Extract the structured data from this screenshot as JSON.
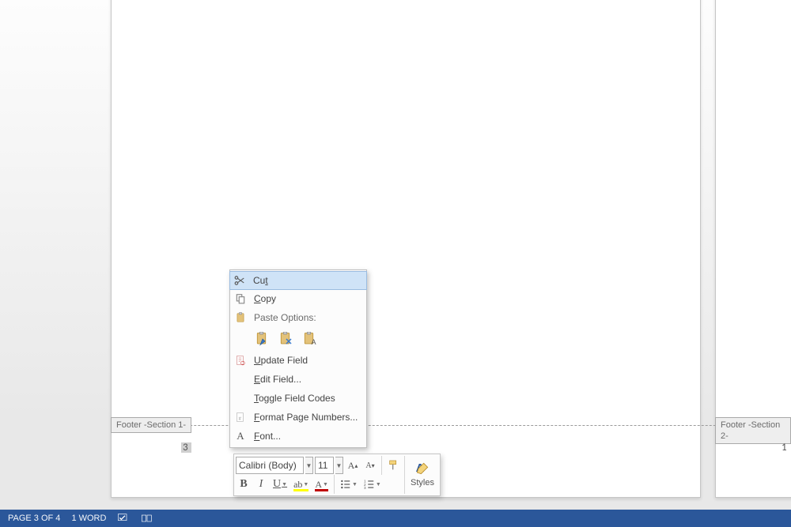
{
  "footer_tabs": {
    "left": "Footer -Section 1-",
    "right": "Footer -Section 2-"
  },
  "page_numbers": {
    "left": "3",
    "right": "1"
  },
  "context_menu": {
    "cut": "Cut",
    "copy": "Copy",
    "paste_options": "Paste Options:",
    "update_field": "Update Field",
    "edit_field": "Edit Field...",
    "toggle_field_codes": "Toggle Field Codes",
    "format_page_numbers": "Format Page Numbers...",
    "font": "Font..."
  },
  "mini_toolbar": {
    "font_name": "Calibri (Body)",
    "font_size": "11",
    "styles_label": "Styles"
  },
  "status_bar": {
    "page_info": "PAGE 3 OF 4",
    "word_count": "1 WORD"
  },
  "colors": {
    "highlight": "#ffff00",
    "font_color": "#c00000",
    "accent": "#2b579a"
  }
}
